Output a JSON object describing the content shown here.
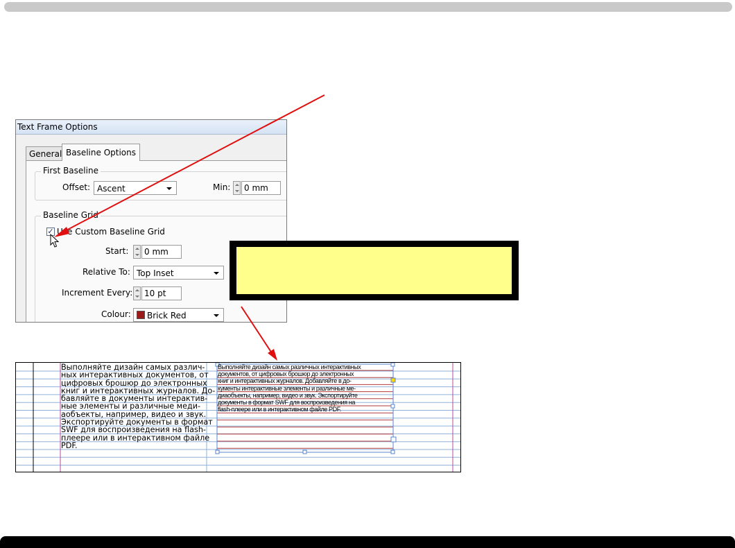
{
  "dialog": {
    "title": "Text Frame Options",
    "tabs": [
      {
        "label": "General",
        "active": false
      },
      {
        "label": "Baseline Options",
        "active": true
      }
    ],
    "first_baseline": {
      "group_label": "First Baseline",
      "offset_label": "Offset:",
      "offset_value": "Ascent",
      "min_label": "Min:",
      "min_value": "0 mm"
    },
    "baseline_grid": {
      "group_label": "Baseline Grid",
      "use_custom_label": "Use Custom Baseline Grid",
      "use_custom_checked": true,
      "start_label": "Start:",
      "start_value": "0 mm",
      "relative_to_label": "Relative To:",
      "relative_to_value": "Top Inset",
      "increment_label": "Increment Every:",
      "increment_value": "10 pt",
      "colour_label": "Colour:",
      "colour_value": "Brick Red",
      "colour_swatch": "#9b1b1b"
    }
  },
  "document": {
    "left_column_lines": [
      "Выполняйте дизайн самых различ-",
      "ных интерактивных документов, от",
      "цифровых брошюр до электронных",
      "книг и интерактивных журналов. До-",
      "бавляйте в документы интерактив-",
      "ные элементы и различные меди-",
      "аобъекты, например, видео и звук.",
      "Экспортируйте документы в формат",
      "SWF для воспроизведения на flash-",
      "плеере или в интерактивном файле",
      "PDF."
    ],
    "right_frame_lines": [
      "Выполняйте дизайн самых различных интерактивных",
      "документов, от цифровых брошюр до электронных",
      "книг и интерактивных журналов. Добавляйте в до-",
      "кументы интерактивные элементы и различные ме-",
      "диаобъекты, например, видео и звук. Экспортируйте",
      "документы в формат SWF для воспроизведения на",
      "flash-плеере или в интерактивном файле PDF."
    ],
    "grid_color_blue": "#8fb1d9",
    "grid_color_red": "#b23a3a"
  },
  "colors": {
    "callout_fill": "#ffff8c",
    "arrow": "#e01010"
  }
}
